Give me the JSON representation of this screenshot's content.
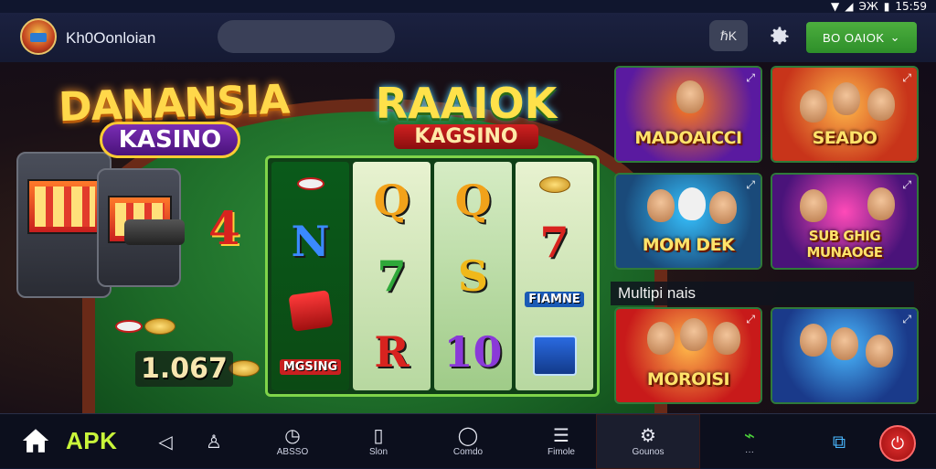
{
  "status_bar": {
    "icons": [
      "wifi-icon",
      "signal-icon"
    ],
    "text": "ЭЖ",
    "battery_icon": "battery-icon",
    "time": "15:59"
  },
  "header": {
    "app_title": "Kh0Oonloian",
    "search_placeholder": "",
    "box_button_label": "ℏK",
    "cta_label": "BO OAIOK"
  },
  "promo": {
    "left_logo_title": "DANANSIA",
    "left_logo_sub": "KASINO",
    "mid_logo_title": "RAAIOK",
    "mid_logo_sub": "KAGSINO",
    "table_number": "4",
    "balance": "1.067"
  },
  "reels": [
    {
      "symbols": [
        "N"
      ]
    },
    {
      "symbols": [
        "Q",
        "7",
        "R"
      ]
    },
    {
      "symbols": [
        "Q",
        "S",
        "10"
      ]
    },
    {
      "symbols": [
        "7"
      ]
    }
  ],
  "reel_labels": {
    "dice_label": "MGSING",
    "face_label": "FIAMNE"
  },
  "games_top": [
    {
      "title": "MADOAICCI",
      "colors": [
        "#5a1aa0",
        "#ff7a1a"
      ]
    },
    {
      "title": "SEADO",
      "colors": [
        "#ff7a1a",
        "#c8341a"
      ]
    },
    {
      "title": "MOM DEK",
      "colors": [
        "#1a6aa0",
        "#36c2ff"
      ]
    },
    {
      "title": "SUB GHIG MUNAOGE",
      "colors": [
        "#7a1ab5",
        "#ff4ab8"
      ]
    }
  ],
  "section_label": "Multipi nais",
  "games_bottom": [
    {
      "title": "MOROISI",
      "colors": [
        "#ff8a1a",
        "#c81a1a"
      ]
    },
    {
      "title": "",
      "colors": [
        "#1a5ab5",
        "#4ab8ff"
      ]
    }
  ],
  "bottom_nav": [
    {
      "id": "home",
      "icon": "home-icon",
      "label": ""
    },
    {
      "id": "apk",
      "icon": "",
      "label": "APK"
    },
    {
      "id": "back",
      "icon": "back-arrow-icon",
      "label": ""
    },
    {
      "id": "profile",
      "icon": "user-gift-icon",
      "label": ""
    },
    {
      "id": "nav1",
      "icon": "timer-icon",
      "label": "ABSSO"
    },
    {
      "id": "nav2",
      "icon": "page-icon",
      "label": "Slon"
    },
    {
      "id": "nav3",
      "icon": "bulb-icon",
      "label": "Comdo"
    },
    {
      "id": "nav4",
      "icon": "list-icon",
      "label": "Fimole"
    },
    {
      "id": "nav5",
      "icon": "gear-icon",
      "label": "Gounos"
    },
    {
      "id": "nav6",
      "icon": "signal-green-icon",
      "label": ""
    },
    {
      "id": "nav7",
      "icon": "share-box-icon",
      "label": ""
    },
    {
      "id": "power",
      "icon": "power-icon",
      "label": ""
    }
  ]
}
